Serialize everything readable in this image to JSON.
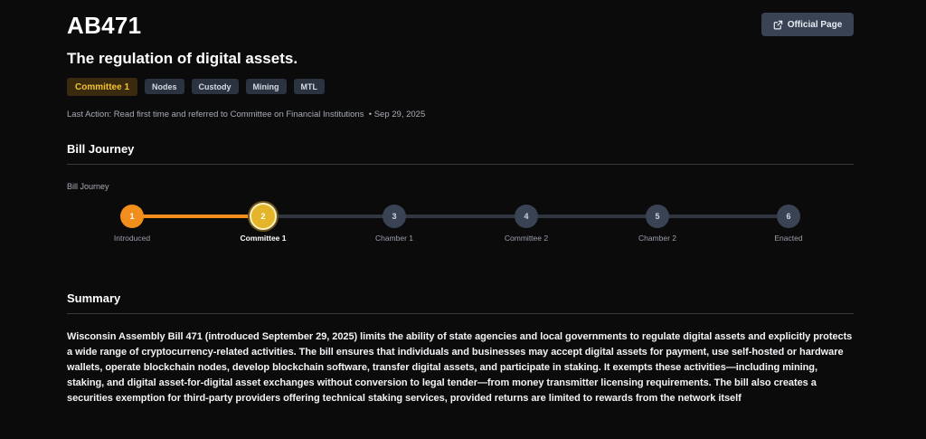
{
  "bill": {
    "id": "AB471",
    "title": "The regulation of digital assets.",
    "official_page_label": "Official Page"
  },
  "tags": [
    "Committee 1",
    "Nodes",
    "Custody",
    "Mining",
    "MTL"
  ],
  "last_action": {
    "label": "Last Action:",
    "text": "Read first time and referred to Committee on Financial Institutions",
    "separator": "•",
    "date": "Sep 29, 2025"
  },
  "journey": {
    "section_title": "Bill Journey",
    "label": "Bill Journey",
    "current_index": 1,
    "steps": [
      {
        "number": "1",
        "label": "Introduced",
        "status": "complete"
      },
      {
        "number": "2",
        "label": "Committee 1",
        "status": "current"
      },
      {
        "number": "3",
        "label": "Chamber 1",
        "status": "pending"
      },
      {
        "number": "4",
        "label": "Committee 2",
        "status": "pending"
      },
      {
        "number": "5",
        "label": "Chamber 2",
        "status": "pending"
      },
      {
        "number": "6",
        "label": "Enacted",
        "status": "pending"
      }
    ]
  },
  "summary": {
    "section_title": "Summary",
    "text": "Wisconsin Assembly Bill 471 (introduced September 29, 2025) limits the ability of state agencies and local governments to regulate digital assets and explicitly protects a wide range of cryptocurrency-related activities. The bill ensures that individuals and businesses may accept digital assets for payment, use self-hosted or hardware wallets, operate blockchain nodes, develop blockchain software, transfer digital assets, and participate in staking. It exempts these activities—including mining, staking, and digital asset-for-digital asset exchanges without conversion to legal tender—from money transmitter licensing requirements. The bill also creates a securities exemption for third-party providers offering technical staking services, provided returns are limited to rewards from the network itself"
  },
  "colors": {
    "background": "#0b0b0c",
    "accent_orange": "#f28e1c",
    "accent_yellow": "#e4b42a",
    "pending": "#3a4354"
  },
  "icons": {
    "official_page": "external-link-icon"
  }
}
